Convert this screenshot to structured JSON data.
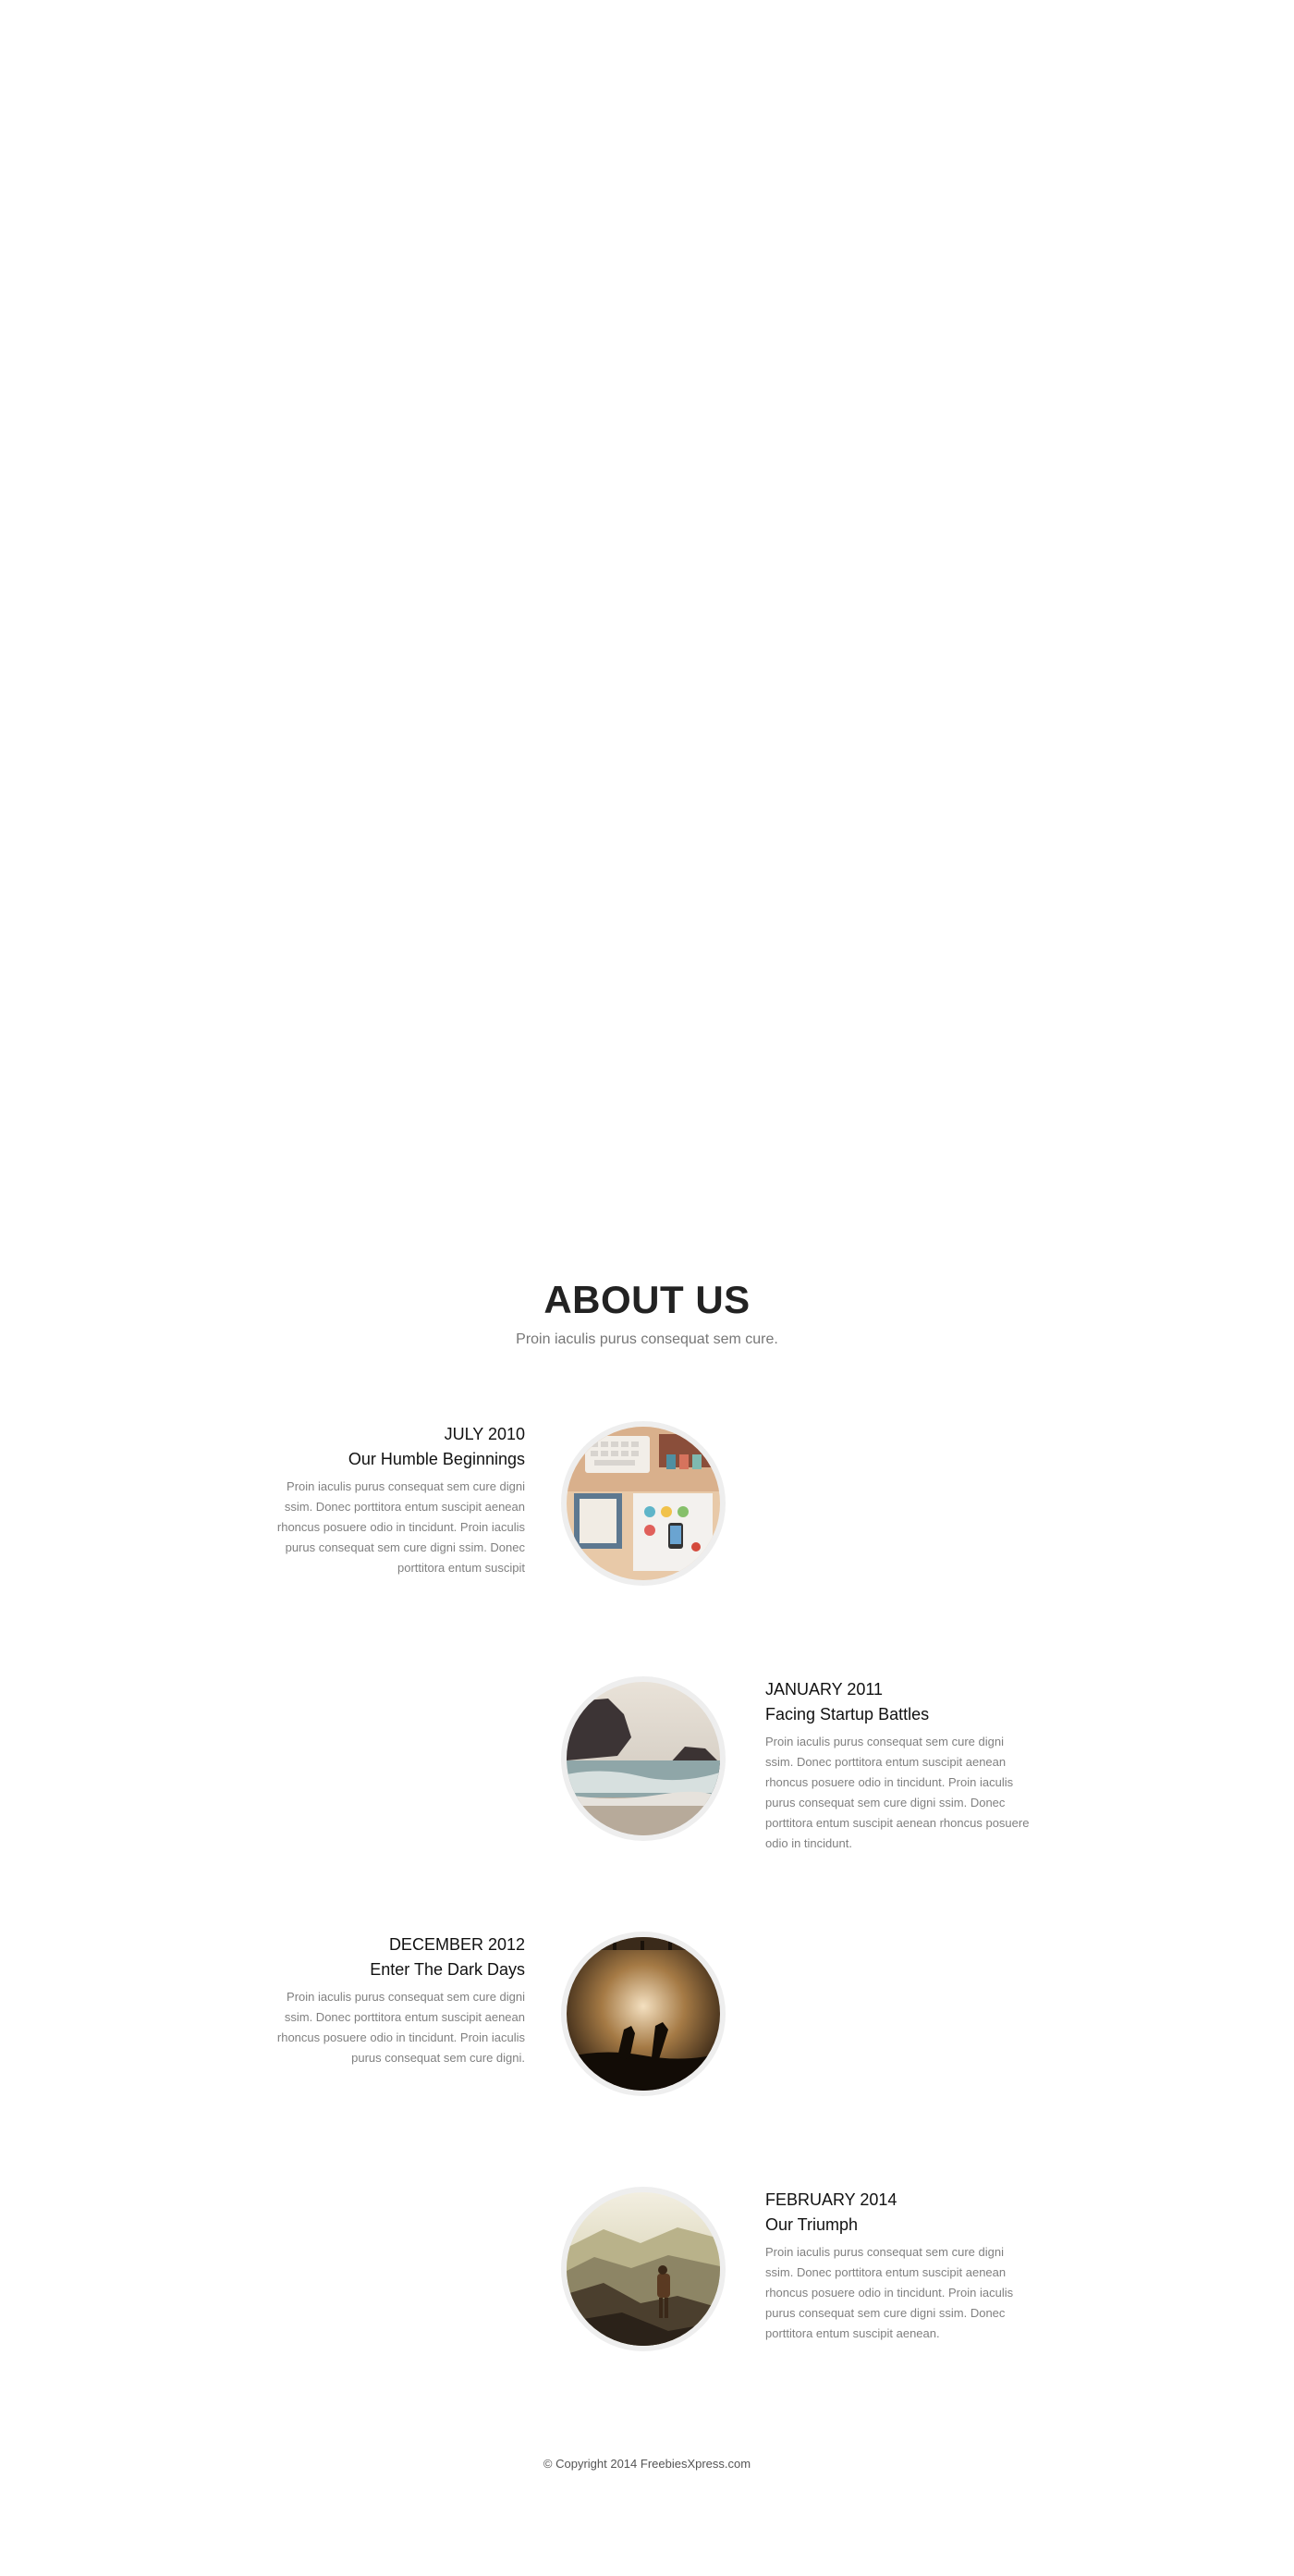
{
  "about": {
    "title": "ABOUT US",
    "subtitle": "Proin iaculis purus consequat sem cure."
  },
  "timeline": [
    {
      "date": "JULY 2010",
      "heading": "Our Humble Beginnings",
      "body": "Proin iaculis purus consequat sem cure digni ssim. Donec porttitora entum suscipit aenean rhoncus posuere odio in tincidunt. Proin iaculis purus consequat sem cure digni ssim. Donec porttitora entum suscipit",
      "side": "left",
      "image_icon": "desk-workspace-photo"
    },
    {
      "date": "JANUARY 2011",
      "heading": "Facing Startup Battles",
      "body": "Proin iaculis purus consequat sem cure digni ssim. Donec porttitora entum suscipit aenean rhoncus posuere odio in tincidunt. Proin iaculis purus consequat sem cure digni ssim. Donec porttitora entum suscipit aenean rhoncus posuere odio in tincidunt.",
      "side": "right",
      "image_icon": "sea-rocks-photo"
    },
    {
      "date": "DECEMBER 2012",
      "heading": "Enter The Dark Days",
      "body": "Proin iaculis purus consequat sem cure digni ssim. Donec porttitora entum suscipit aenean rhoncus posuere odio in tincidunt. Proin iaculis purus consequat sem cure digni.",
      "side": "left",
      "image_icon": "concert-crowd-photo"
    },
    {
      "date": "FEBRUARY 2014",
      "heading": "Our Triumph",
      "body": "Proin iaculis purus consequat sem cure digni ssim. Donec porttitora entum suscipit aenean rhoncus posuere odio in tincidunt. Proin iaculis purus consequat sem cure digni ssim. Donec porttitora entum suscipit aenean.",
      "side": "right",
      "image_icon": "mountain-hiker-photo"
    }
  ],
  "footer": {
    "copyright": "© Copyright 2014 FreebiesXpress.com"
  },
  "colors": {
    "background": "#ffffff",
    "heading": "#222222",
    "body_text": "#808080",
    "image_ring": "#eeeeee"
  }
}
